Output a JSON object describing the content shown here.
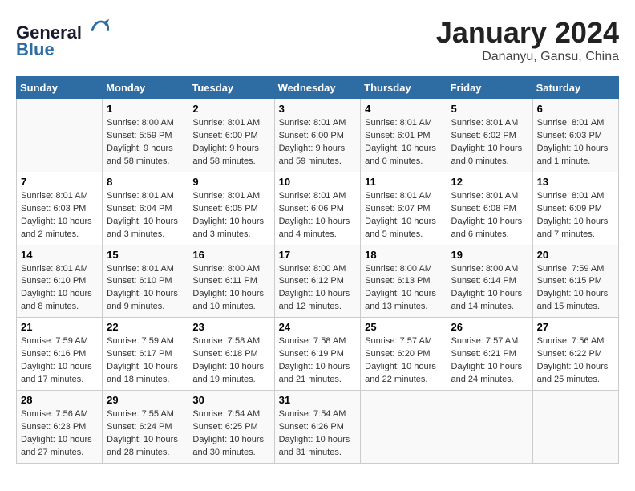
{
  "header": {
    "logo_line1": "General",
    "logo_line2": "Blue",
    "month": "January 2024",
    "location": "Dananyu, Gansu, China"
  },
  "days_of_week": [
    "Sunday",
    "Monday",
    "Tuesday",
    "Wednesday",
    "Thursday",
    "Friday",
    "Saturday"
  ],
  "weeks": [
    [
      {
        "day": "",
        "sunrise": "",
        "sunset": "",
        "daylight": ""
      },
      {
        "day": "1",
        "sunrise": "Sunrise: 8:00 AM",
        "sunset": "Sunset: 5:59 PM",
        "daylight": "Daylight: 9 hours and 58 minutes."
      },
      {
        "day": "2",
        "sunrise": "Sunrise: 8:01 AM",
        "sunset": "Sunset: 6:00 PM",
        "daylight": "Daylight: 9 hours and 58 minutes."
      },
      {
        "day": "3",
        "sunrise": "Sunrise: 8:01 AM",
        "sunset": "Sunset: 6:00 PM",
        "daylight": "Daylight: 9 hours and 59 minutes."
      },
      {
        "day": "4",
        "sunrise": "Sunrise: 8:01 AM",
        "sunset": "Sunset: 6:01 PM",
        "daylight": "Daylight: 10 hours and 0 minutes."
      },
      {
        "day": "5",
        "sunrise": "Sunrise: 8:01 AM",
        "sunset": "Sunset: 6:02 PM",
        "daylight": "Daylight: 10 hours and 0 minutes."
      },
      {
        "day": "6",
        "sunrise": "Sunrise: 8:01 AM",
        "sunset": "Sunset: 6:03 PM",
        "daylight": "Daylight: 10 hours and 1 minute."
      }
    ],
    [
      {
        "day": "7",
        "sunrise": "Sunrise: 8:01 AM",
        "sunset": "Sunset: 6:03 PM",
        "daylight": "Daylight: 10 hours and 2 minutes."
      },
      {
        "day": "8",
        "sunrise": "Sunrise: 8:01 AM",
        "sunset": "Sunset: 6:04 PM",
        "daylight": "Daylight: 10 hours and 3 minutes."
      },
      {
        "day": "9",
        "sunrise": "Sunrise: 8:01 AM",
        "sunset": "Sunset: 6:05 PM",
        "daylight": "Daylight: 10 hours and 3 minutes."
      },
      {
        "day": "10",
        "sunrise": "Sunrise: 8:01 AM",
        "sunset": "Sunset: 6:06 PM",
        "daylight": "Daylight: 10 hours and 4 minutes."
      },
      {
        "day": "11",
        "sunrise": "Sunrise: 8:01 AM",
        "sunset": "Sunset: 6:07 PM",
        "daylight": "Daylight: 10 hours and 5 minutes."
      },
      {
        "day": "12",
        "sunrise": "Sunrise: 8:01 AM",
        "sunset": "Sunset: 6:08 PM",
        "daylight": "Daylight: 10 hours and 6 minutes."
      },
      {
        "day": "13",
        "sunrise": "Sunrise: 8:01 AM",
        "sunset": "Sunset: 6:09 PM",
        "daylight": "Daylight: 10 hours and 7 minutes."
      }
    ],
    [
      {
        "day": "14",
        "sunrise": "Sunrise: 8:01 AM",
        "sunset": "Sunset: 6:10 PM",
        "daylight": "Daylight: 10 hours and 8 minutes."
      },
      {
        "day": "15",
        "sunrise": "Sunrise: 8:01 AM",
        "sunset": "Sunset: 6:10 PM",
        "daylight": "Daylight: 10 hours and 9 minutes."
      },
      {
        "day": "16",
        "sunrise": "Sunrise: 8:00 AM",
        "sunset": "Sunset: 6:11 PM",
        "daylight": "Daylight: 10 hours and 10 minutes."
      },
      {
        "day": "17",
        "sunrise": "Sunrise: 8:00 AM",
        "sunset": "Sunset: 6:12 PM",
        "daylight": "Daylight: 10 hours and 12 minutes."
      },
      {
        "day": "18",
        "sunrise": "Sunrise: 8:00 AM",
        "sunset": "Sunset: 6:13 PM",
        "daylight": "Daylight: 10 hours and 13 minutes."
      },
      {
        "day": "19",
        "sunrise": "Sunrise: 8:00 AM",
        "sunset": "Sunset: 6:14 PM",
        "daylight": "Daylight: 10 hours and 14 minutes."
      },
      {
        "day": "20",
        "sunrise": "Sunrise: 7:59 AM",
        "sunset": "Sunset: 6:15 PM",
        "daylight": "Daylight: 10 hours and 15 minutes."
      }
    ],
    [
      {
        "day": "21",
        "sunrise": "Sunrise: 7:59 AM",
        "sunset": "Sunset: 6:16 PM",
        "daylight": "Daylight: 10 hours and 17 minutes."
      },
      {
        "day": "22",
        "sunrise": "Sunrise: 7:59 AM",
        "sunset": "Sunset: 6:17 PM",
        "daylight": "Daylight: 10 hours and 18 minutes."
      },
      {
        "day": "23",
        "sunrise": "Sunrise: 7:58 AM",
        "sunset": "Sunset: 6:18 PM",
        "daylight": "Daylight: 10 hours and 19 minutes."
      },
      {
        "day": "24",
        "sunrise": "Sunrise: 7:58 AM",
        "sunset": "Sunset: 6:19 PM",
        "daylight": "Daylight: 10 hours and 21 minutes."
      },
      {
        "day": "25",
        "sunrise": "Sunrise: 7:57 AM",
        "sunset": "Sunset: 6:20 PM",
        "daylight": "Daylight: 10 hours and 22 minutes."
      },
      {
        "day": "26",
        "sunrise": "Sunrise: 7:57 AM",
        "sunset": "Sunset: 6:21 PM",
        "daylight": "Daylight: 10 hours and 24 minutes."
      },
      {
        "day": "27",
        "sunrise": "Sunrise: 7:56 AM",
        "sunset": "Sunset: 6:22 PM",
        "daylight": "Daylight: 10 hours and 25 minutes."
      }
    ],
    [
      {
        "day": "28",
        "sunrise": "Sunrise: 7:56 AM",
        "sunset": "Sunset: 6:23 PM",
        "daylight": "Daylight: 10 hours and 27 minutes."
      },
      {
        "day": "29",
        "sunrise": "Sunrise: 7:55 AM",
        "sunset": "Sunset: 6:24 PM",
        "daylight": "Daylight: 10 hours and 28 minutes."
      },
      {
        "day": "30",
        "sunrise": "Sunrise: 7:54 AM",
        "sunset": "Sunset: 6:25 PM",
        "daylight": "Daylight: 10 hours and 30 minutes."
      },
      {
        "day": "31",
        "sunrise": "Sunrise: 7:54 AM",
        "sunset": "Sunset: 6:26 PM",
        "daylight": "Daylight: 10 hours and 31 minutes."
      },
      {
        "day": "",
        "sunrise": "",
        "sunset": "",
        "daylight": ""
      },
      {
        "day": "",
        "sunrise": "",
        "sunset": "",
        "daylight": ""
      },
      {
        "day": "",
        "sunrise": "",
        "sunset": "",
        "daylight": ""
      }
    ]
  ]
}
